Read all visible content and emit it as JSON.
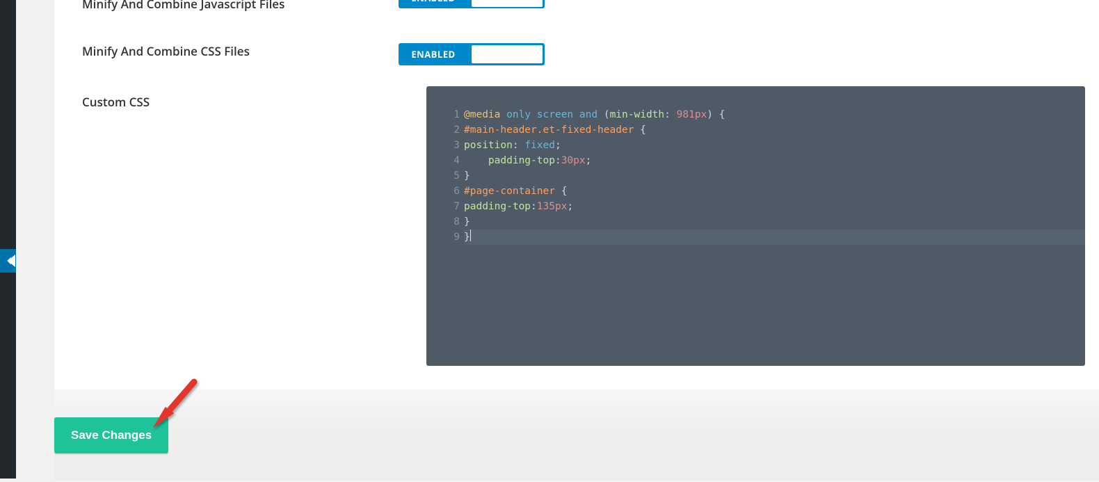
{
  "settings": {
    "minify_js": {
      "label": "Minify And Combine Javascript Files",
      "state": "ENABLED"
    },
    "minify_css": {
      "label": "Minify And Combine CSS Files",
      "state": "ENABLED"
    },
    "custom_css": {
      "label": "Custom CSS"
    }
  },
  "code": {
    "lines": [
      {
        "n": "1",
        "tokens": [
          {
            "c": "tok-atrule",
            "t": "@media"
          },
          {
            "c": "tok-plain",
            "t": " "
          },
          {
            "c": "tok-kw",
            "t": "only"
          },
          {
            "c": "tok-plain",
            "t": " "
          },
          {
            "c": "tok-kw",
            "t": "screen"
          },
          {
            "c": "tok-plain",
            "t": " "
          },
          {
            "c": "tok-kw",
            "t": "and"
          },
          {
            "c": "tok-plain",
            "t": " "
          },
          {
            "c": "tok-punc",
            "t": "("
          },
          {
            "c": "tok-prop",
            "t": "min-width"
          },
          {
            "c": "tok-punc",
            "t": ":"
          },
          {
            "c": "tok-plain",
            "t": " "
          },
          {
            "c": "tok-num",
            "t": "981px"
          },
          {
            "c": "tok-punc",
            "t": ")"
          },
          {
            "c": "tok-plain",
            "t": " "
          },
          {
            "c": "tok-punc",
            "t": "{"
          }
        ]
      },
      {
        "n": "2",
        "tokens": [
          {
            "c": "tok-sel",
            "t": "#main-header.et-fixed-header"
          },
          {
            "c": "tok-plain",
            "t": " "
          },
          {
            "c": "tok-punc",
            "t": "{"
          }
        ]
      },
      {
        "n": "3",
        "tokens": [
          {
            "c": "tok-prop",
            "t": "position"
          },
          {
            "c": "tok-punc",
            "t": ":"
          },
          {
            "c": "tok-plain",
            "t": " "
          },
          {
            "c": "tok-kw",
            "t": "fixed"
          },
          {
            "c": "tok-punc",
            "t": ";"
          }
        ]
      },
      {
        "n": "4",
        "tokens": [
          {
            "c": "tok-plain",
            "t": "    "
          },
          {
            "c": "tok-prop",
            "t": "padding-top"
          },
          {
            "c": "tok-punc",
            "t": ":"
          },
          {
            "c": "tok-num",
            "t": "30px"
          },
          {
            "c": "tok-punc",
            "t": ";"
          }
        ]
      },
      {
        "n": "5",
        "tokens": [
          {
            "c": "tok-punc",
            "t": "}"
          }
        ]
      },
      {
        "n": "6",
        "tokens": [
          {
            "c": "tok-sel",
            "t": "#page-container"
          },
          {
            "c": "tok-plain",
            "t": " "
          },
          {
            "c": "tok-punc",
            "t": "{"
          }
        ]
      },
      {
        "n": "7",
        "tokens": [
          {
            "c": "tok-prop",
            "t": "padding-top"
          },
          {
            "c": "tok-punc",
            "t": ":"
          },
          {
            "c": "tok-num",
            "t": "135px"
          },
          {
            "c": "tok-punc",
            "t": ";"
          }
        ]
      },
      {
        "n": "8",
        "tokens": [
          {
            "c": "tok-punc",
            "t": "}"
          }
        ]
      },
      {
        "n": "9",
        "active": true,
        "tokens": [
          {
            "c": "tok-punc",
            "t": "}"
          }
        ]
      }
    ]
  },
  "buttons": {
    "save": "Save Changes"
  }
}
